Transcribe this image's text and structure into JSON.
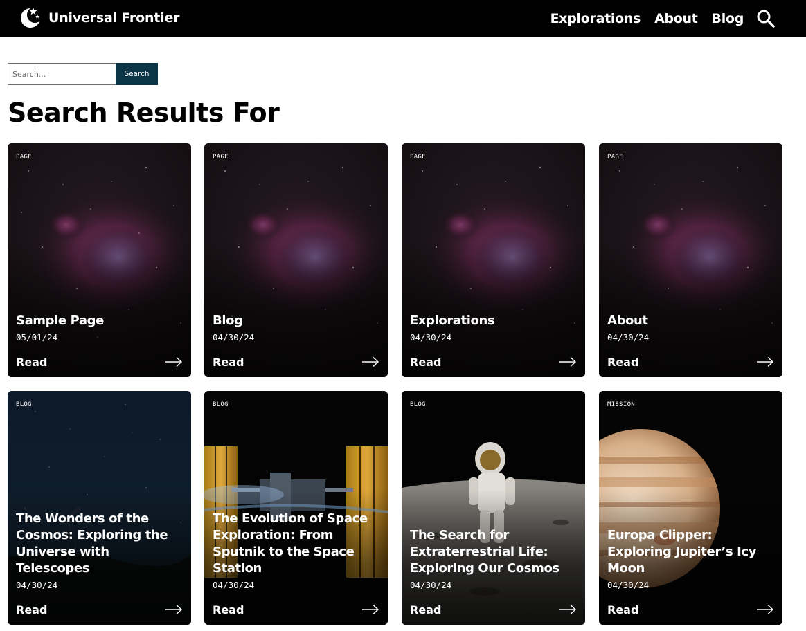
{
  "header": {
    "brand": "Universal Frontier",
    "nav": [
      "Explorations",
      "About",
      "Blog"
    ]
  },
  "search": {
    "placeholder": "Search...",
    "value": "",
    "button_label": "Search"
  },
  "page": {
    "title": "Search Results For"
  },
  "cards": [
    {
      "tag": "PAGE",
      "title": "Sample Page",
      "date": "05/01/24",
      "read": "Read",
      "image": "orion-nebula"
    },
    {
      "tag": "PAGE",
      "title": "Blog",
      "date": "04/30/24",
      "read": "Read",
      "image": "orion-nebula"
    },
    {
      "tag": "PAGE",
      "title": "Explorations",
      "date": "04/30/24",
      "read": "Read",
      "image": "orion-nebula"
    },
    {
      "tag": "PAGE",
      "title": "About",
      "date": "04/30/24",
      "read": "Read",
      "image": "orion-nebula"
    },
    {
      "tag": "BLOG",
      "title": "The Wonders of the Cosmos: Exploring the Universe with Telescopes",
      "date": "04/30/24",
      "read": "Read",
      "image": "night-sky-telescope"
    },
    {
      "tag": "BLOG",
      "title": "The Evolution of Space Exploration: From Sputnik to the Space Station",
      "date": "04/30/24",
      "read": "Read",
      "image": "space-station"
    },
    {
      "tag": "BLOG",
      "title": "The Search for Extraterrestrial Life: Exploring Our Cosmos",
      "date": "04/30/24",
      "read": "Read",
      "image": "astronaut-on-moon"
    },
    {
      "tag": "MISSION",
      "title": "Europa Clipper: Exploring Jupiter’s Icy Moon",
      "date": "04/30/24",
      "read": "Read",
      "image": "jupiter"
    }
  ]
}
